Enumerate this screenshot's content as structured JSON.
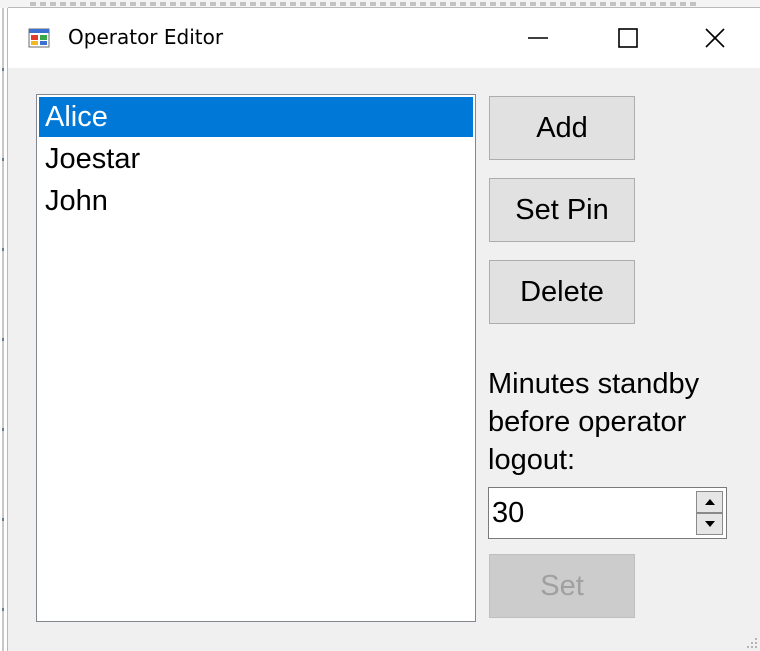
{
  "window": {
    "title": "Operator Editor"
  },
  "titlebar_buttons": {
    "minimize": "minimize",
    "maximize": "maximize",
    "close": "close"
  },
  "operators": [
    "Alice",
    "Joestar",
    "John"
  ],
  "selected_operator": "Alice",
  "buttons": {
    "add": "Add",
    "set_pin": "Set Pin",
    "delete": "Delete",
    "set": "Set"
  },
  "standby": {
    "caption_lines": [
      "Minutes standby",
      "before operator",
      "logout:"
    ],
    "value": "30"
  },
  "colors": {
    "selection": "#0078d7",
    "dialog_bg": "#f0f0f0",
    "button_bg": "#e1e1e1"
  }
}
